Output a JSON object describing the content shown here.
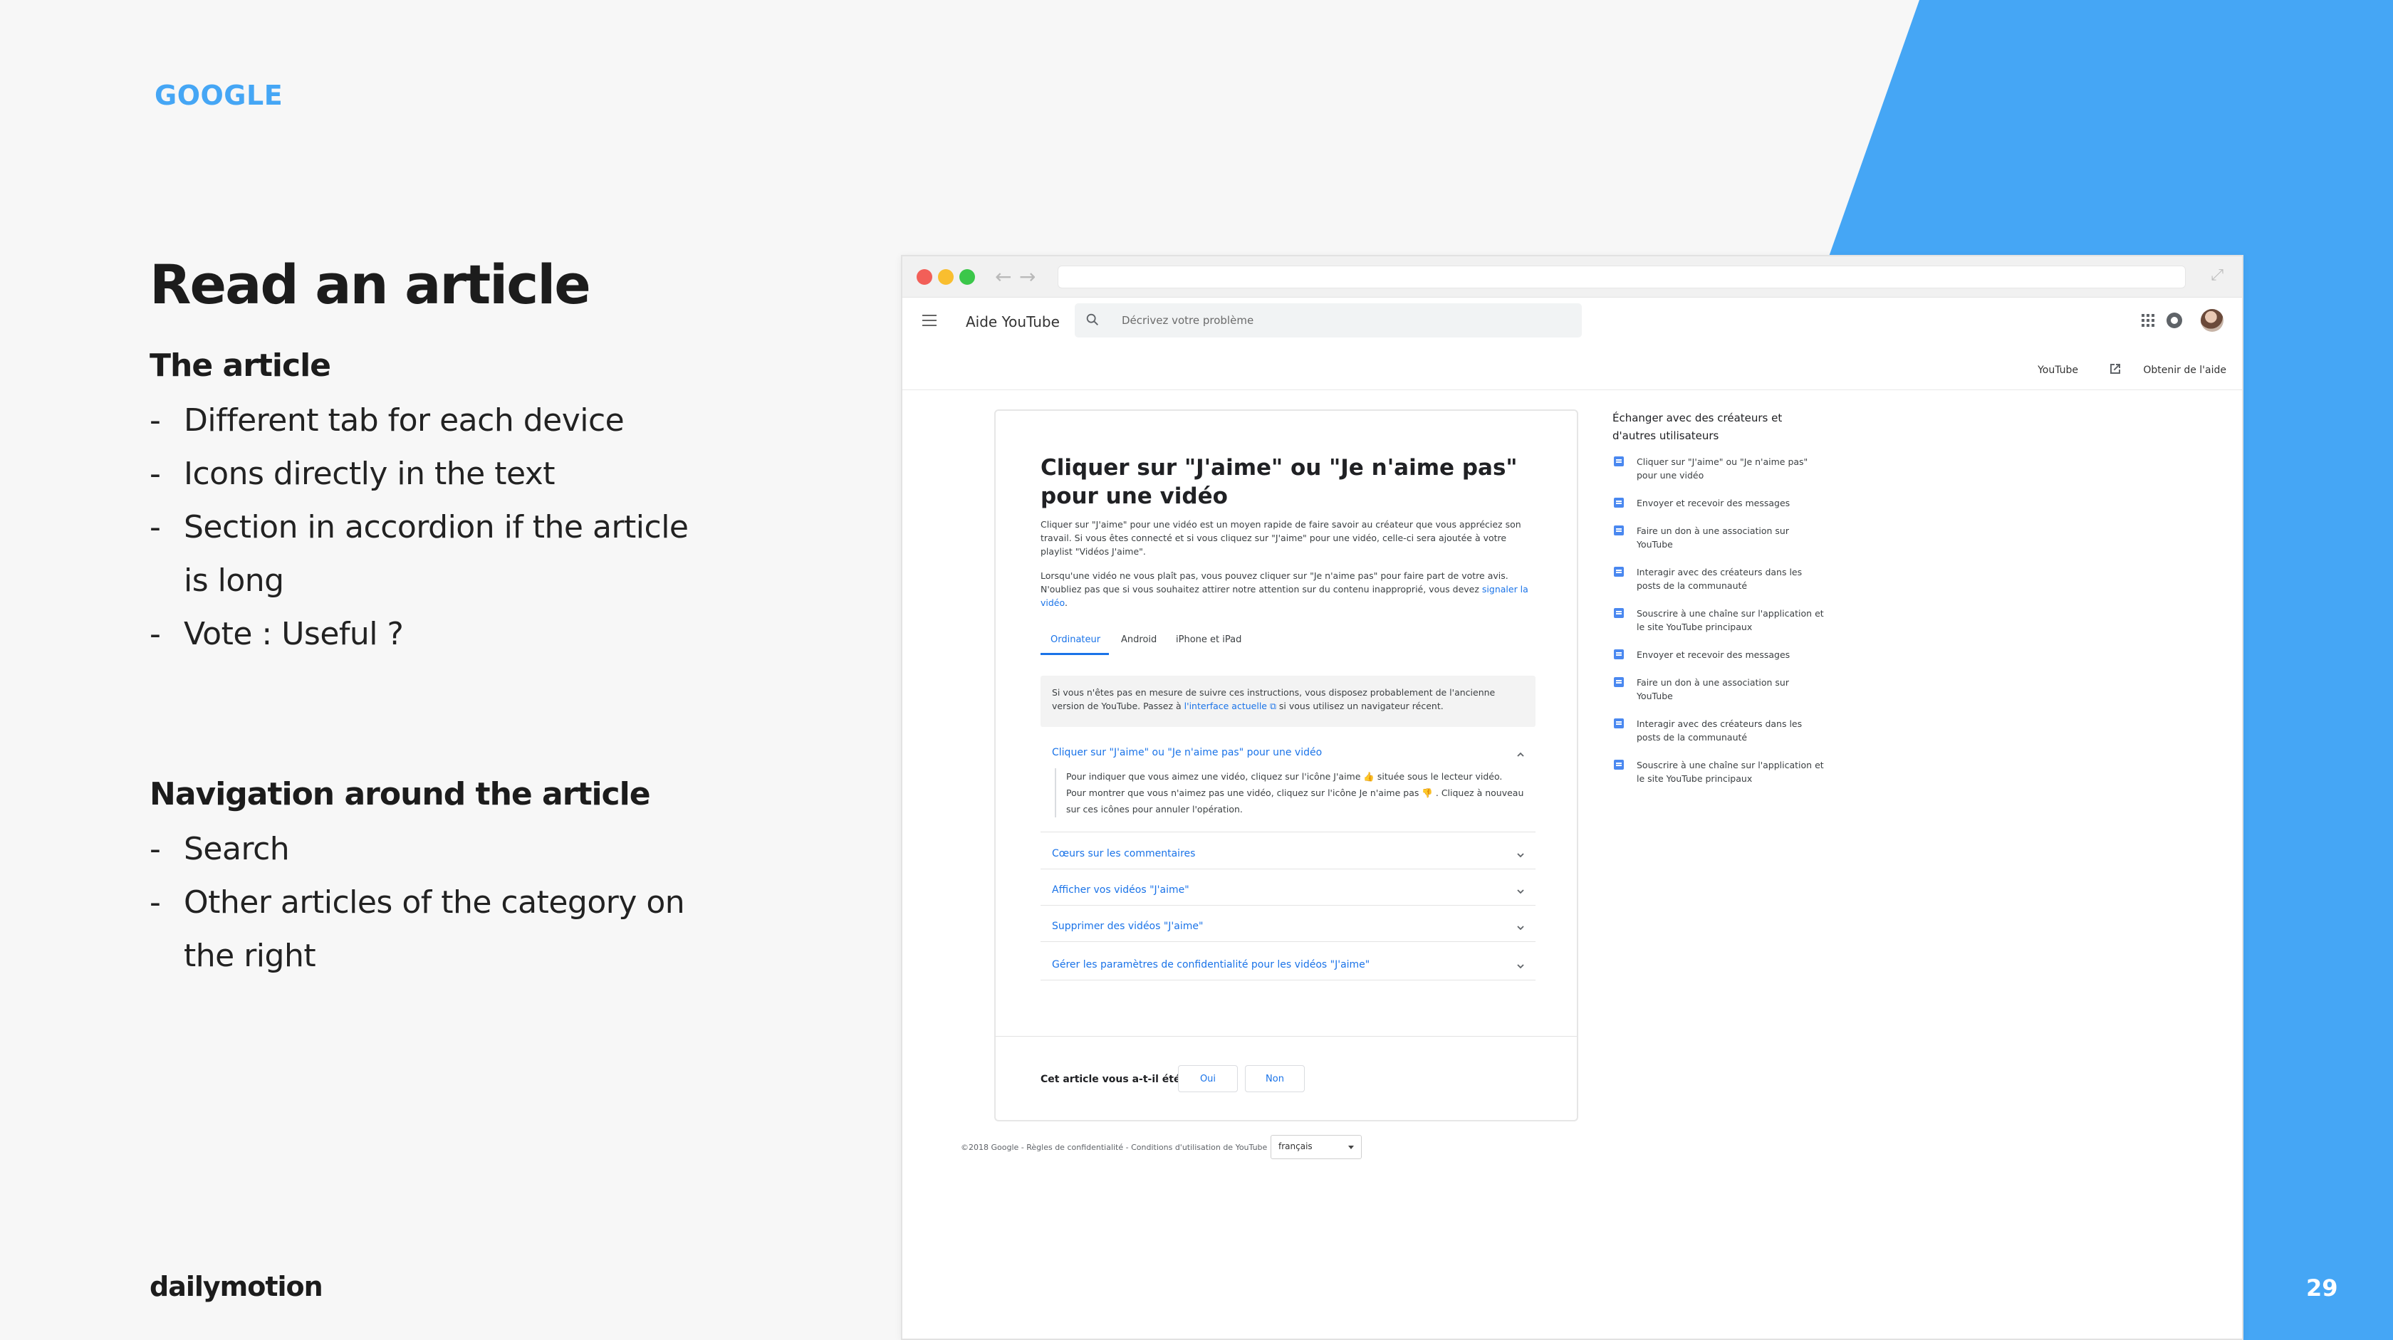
{
  "slide": {
    "brand": "GOOGLE",
    "title": "Read an article",
    "section1": {
      "heading": "The article",
      "items": [
        "Different tab for each device",
        "Icons directly in the text",
        "Section in accordion if the article is long",
        "Vote : Useful ?"
      ]
    },
    "section2": {
      "heading": "Navigation around the article",
      "items": [
        "Search",
        "Other articles of the category on the right"
      ]
    },
    "logo": "dailymotion",
    "page_number": "29",
    "accent_color": "#45a6f5"
  },
  "browser": {
    "app_title": "Aide YouTube",
    "search_placeholder": "Décrivez votre problème",
    "subheader": {
      "youtube_link": "YouTube",
      "help_link": "Obtenir de l'aide"
    },
    "article": {
      "title": "Cliquer sur \"J'aime\" ou \"Je n'aime pas\" pour une vidéo",
      "para1": "Cliquer sur \"J'aime\" pour une vidéo est un moyen rapide de faire savoir au créateur que vous appréciez son travail. Si vous êtes connecté et si vous cliquez sur \"J'aime\" pour une vidéo, celle-ci sera ajoutée à votre playlist \"Vidéos J'aime\".",
      "para2_text": "Lorsqu'une vidéo ne vous plaît pas, vous pouvez cliquer sur \"Je n'aime pas\" pour faire part de votre avis. N'oubliez pas que si vous souhaitez attirer notre attention sur du contenu inapproprié, vous devez",
      "para2_link": "signaler la vidéo",
      "tabs": [
        "Ordinateur",
        "Android",
        "iPhone et iPad"
      ],
      "notice_text1": "Si vous n'êtes pas en mesure de suivre ces instructions, vous disposez probablement de l'ancienne version de YouTube. Passez à",
      "notice_link": "l'interface actuelle",
      "notice_text2": "si vous utilisez un navigateur récent.",
      "accordion_open": {
        "title": "Cliquer sur \"J'aime\" ou \"Je n'aime pas\" pour une vidéo",
        "body": "Pour indiquer que vous aimez une vidéo, cliquez sur l'icône J'aime 👍 située sous le lecteur vidéo. Pour montrer que vous n'aimez pas une vidéo, cliquez sur l'icône Je n'aime pas 👎 . Cliquez à nouveau sur ces icônes pour annuler l'opération."
      },
      "accordion_items": [
        "Cœurs sur les commentaires",
        "Afficher vos vidéos \"J'aime\"",
        "Supprimer des vidéos \"J'aime\"",
        "Gérer les paramètres de confidentialité pour les vidéos \"J'aime\""
      ],
      "vote": {
        "question": "Cet article vous a-t-il été utile ?",
        "yes": "Oui",
        "no": "Non"
      }
    },
    "sidebar": {
      "heading": "Échanger avec des créateurs et d'autres utilisateurs",
      "items": [
        "Cliquer sur \"J'aime\" ou \"Je n'aime pas\" pour une vidéo",
        "Envoyer et recevoir des messages",
        "Faire un don à une association sur YouTube",
        "Interagir avec des créateurs dans les posts de la communauté",
        "Souscrire à une chaîne sur l'application et le site YouTube principaux",
        "Envoyer et recevoir des messages",
        "Faire un don à une association sur YouTube",
        "Interagir avec des créateurs dans les posts de la communauté",
        "Souscrire à une chaîne sur l'application et le site YouTube principaux"
      ]
    },
    "footer": "©2018 Google - Règles de confidentialité - Conditions d'utilisation de YouTube",
    "language": "français",
    "link_color": "#1a73e8"
  }
}
